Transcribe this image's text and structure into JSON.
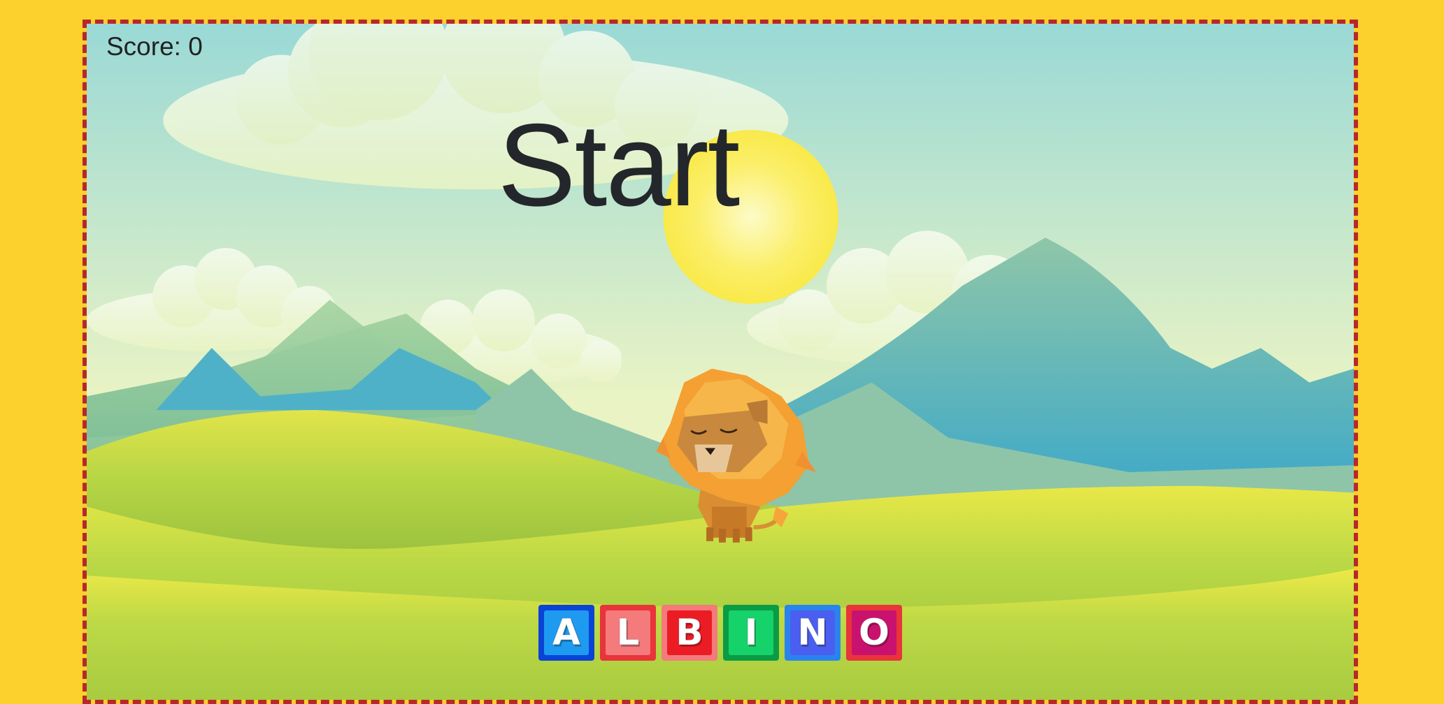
{
  "game": {
    "score_text": "Score: 0",
    "title": "Start",
    "word_tiles": [
      {
        "letter": "A",
        "outer": "#0a43d6",
        "inner": "#1e9bf0"
      },
      {
        "letter": "L",
        "outer": "#e8343a",
        "inner": "#f47a7c"
      },
      {
        "letter": "B",
        "outer": "#f47a7c",
        "inner": "#ec1c24"
      },
      {
        "letter": "I",
        "outer": "#0a9b45",
        "inner": "#16d26a"
      },
      {
        "letter": "N",
        "outer": "#2a84ee",
        "inner": "#4a5ff0"
      },
      {
        "letter": "O",
        "outer": "#e8343a",
        "inner": "#c9126e"
      }
    ]
  },
  "colors": {
    "page_background": "#fdd12d",
    "frame_border": "#b8282a",
    "sky_top": "#9ad9d6",
    "sky_bottom": "#e9f3c4",
    "sun": "#fbee55",
    "mountain": "#4aabc6",
    "hill_light": "#c6dd4c",
    "hill_dark": "#93bd3c"
  }
}
